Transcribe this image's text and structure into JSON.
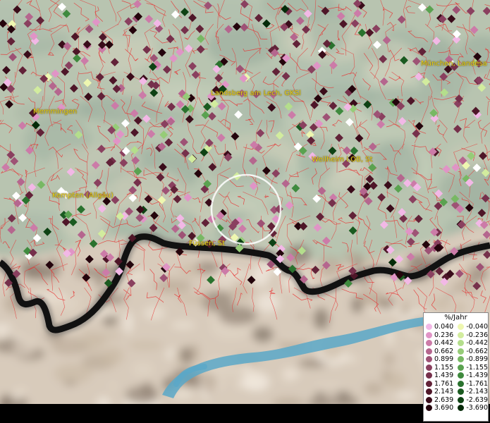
{
  "places": [
    {
      "id": "muenchen",
      "name": "München, Landesa"
    },
    {
      "id": "landsberg",
      "name": "Landsberg am Lech, GKSl"
    },
    {
      "id": "memmingen",
      "name": "Memmingen"
    },
    {
      "id": "weilheim",
      "name": "Weilheim i.OB, St"
    },
    {
      "id": "kempten",
      "name": "Kempten (Allgäu)"
    },
    {
      "id": "fuessen",
      "name": "Füssen, St"
    }
  ],
  "legend": {
    "title": "%/Jahr",
    "positive": [
      {
        "label": "0.040",
        "color": "#f2b8e6"
      },
      {
        "label": "0.236",
        "color": "#e094c6"
      },
      {
        "label": "0.442",
        "color": "#cc7ba8"
      },
      {
        "label": "0.662",
        "color": "#b5668e"
      },
      {
        "label": "0.899",
        "color": "#9e5275"
      },
      {
        "label": "1.155",
        "color": "#8a405f"
      },
      {
        "label": "1.439",
        "color": "#76304b"
      },
      {
        "label": "1.761",
        "color": "#622238"
      },
      {
        "label": "2.143",
        "color": "#4e1628"
      },
      {
        "label": "2.639",
        "color": "#3a0c1a"
      },
      {
        "label": "3.690",
        "color": "#24040c"
      }
    ],
    "negative": [
      {
        "label": "-0.040",
        "color": "#eef7b0"
      },
      {
        "label": "-0.236",
        "color": "#d2ec9e"
      },
      {
        "label": "-0.442",
        "color": "#b4de8c"
      },
      {
        "label": "-0.662",
        "color": "#96cc78"
      },
      {
        "label": "-0.899",
        "color": "#78b864"
      },
      {
        "label": "-1.155",
        "color": "#5aa250"
      },
      {
        "label": "-1.439",
        "color": "#3f8a3e"
      },
      {
        "label": "-1.761",
        "color": "#2a722e"
      },
      {
        "label": "-2.143",
        "color": "#1a5a20"
      },
      {
        "label": "-2.639",
        "color": "#0e4214"
      },
      {
        "label": "-3.690",
        "color": "#042a08"
      }
    ]
  },
  "colors": {
    "border_lines": "#e83030",
    "alpine_border": "#111111",
    "lake": "#5aa8c8",
    "lowland": "#b8c4b0",
    "mountains": "#d8cbbb",
    "selection_circle": "#ffffff",
    "no_data_marker": "#ffffff"
  }
}
